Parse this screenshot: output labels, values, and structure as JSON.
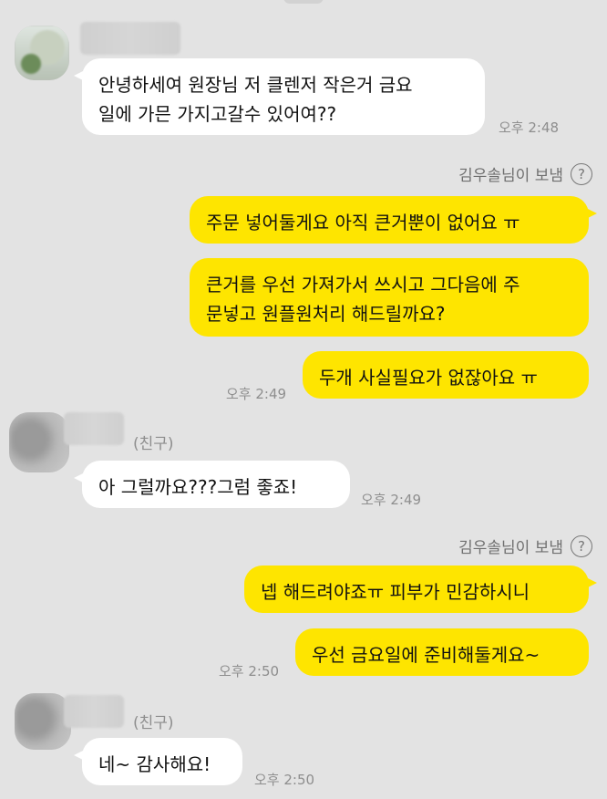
{
  "messages": {
    "m1": {
      "text_line1": "안녕하세여 원장님 저 클렌저 작은거 금요",
      "text_line2": "일에 가믄 가지고갈수 있어여??",
      "time": "오후 2:48"
    },
    "sent_by_1": "김우솔님이 보냄",
    "m2": {
      "text": "주문 넣어둘게요 아직 큰거뿐이 없어요 ㅠ"
    },
    "m3": {
      "text_line1": "큰거를 우선 가져가서 쓰시고 그다음에 주",
      "text_line2": "문넣고 원플원처리 해드릴까요?"
    },
    "m4": {
      "text": "두개 사실필요가 없잖아요 ㅠ",
      "time": "오후 2:49"
    },
    "friend_tag_1": "(친구)",
    "m5": {
      "text": "아 그럴까요???그럼 좋죠!",
      "time": "오후 2:49"
    },
    "sent_by_2": "김우솔님이 보냄",
    "m6": {
      "text": "넵 해드려야죠ㅠ 피부가 민감하시니"
    },
    "m7": {
      "text": "우선 금요일에 준비해둘게요~",
      "time": "오후 2:50"
    },
    "friend_tag_2": "(친구)",
    "m8": {
      "text": "네~ 감사해요!",
      "time": "오후 2:50"
    }
  },
  "icons": {
    "help": "question-circle-icon"
  },
  "colors": {
    "background": "#e3e3e3",
    "outgoing": "#fee500",
    "incoming": "#ffffff"
  }
}
